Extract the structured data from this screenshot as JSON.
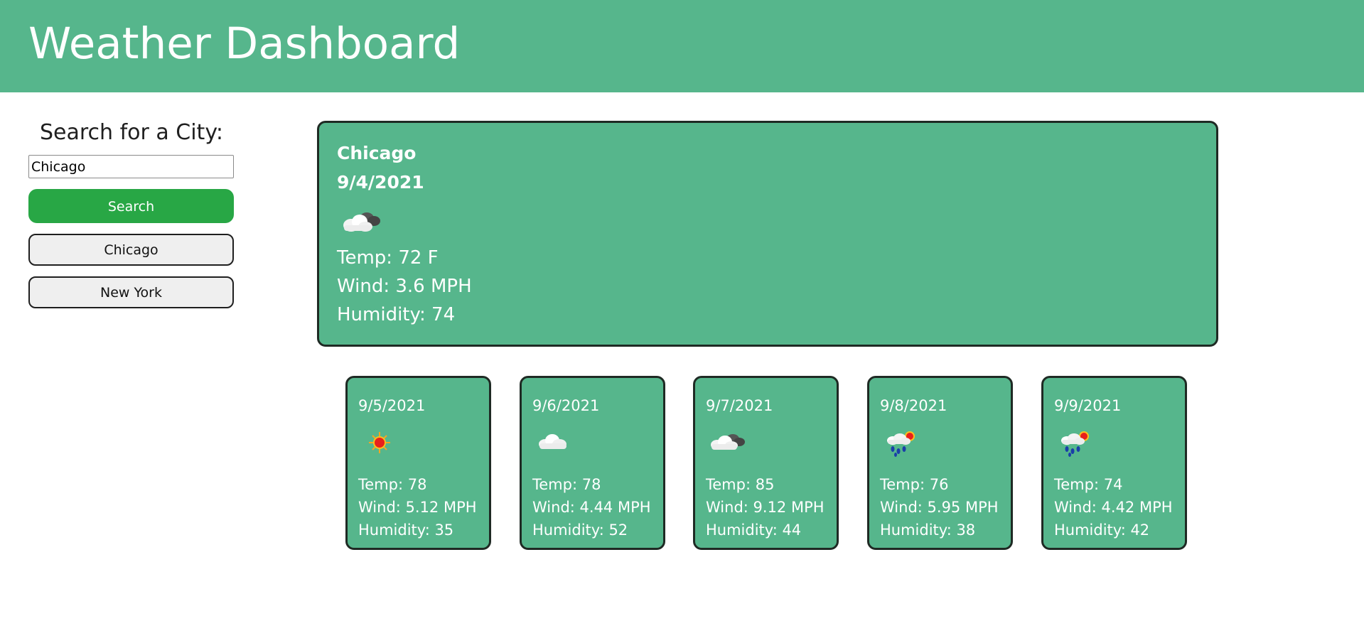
{
  "header": {
    "title": "Weather Dashboard"
  },
  "sidebar": {
    "heading": "Search for a City:",
    "search_value": "Chicago",
    "search_button": "Search",
    "history": [
      "Chicago",
      "New York"
    ]
  },
  "current": {
    "city": "Chicago",
    "date": "9/4/2021",
    "icon": "partly-cloudy-icon",
    "temp": "Temp: 72 F",
    "wind": "Wind: 3.6 MPH",
    "humidity": "Humidity: 74"
  },
  "forecast": [
    {
      "date": "9/5/2021",
      "icon": "sun-icon",
      "temp": "Temp: 78",
      "wind": "Wind: 5.12 MPH",
      "humidity": "Humidity: 35"
    },
    {
      "date": "9/6/2021",
      "icon": "cloud-icon",
      "temp": "Temp: 78",
      "wind": "Wind: 4.44 MPH",
      "humidity": "Humidity: 52"
    },
    {
      "date": "9/7/2021",
      "icon": "partly-cloudy-icon",
      "temp": "Temp: 85",
      "wind": "Wind: 9.12 MPH",
      "humidity": "Humidity: 44"
    },
    {
      "date": "9/8/2021",
      "icon": "rain-sun-icon",
      "temp": "Temp: 76",
      "wind": "Wind: 5.95 MPH",
      "humidity": "Humidity: 38"
    },
    {
      "date": "9/9/2021",
      "icon": "rain-sun-icon",
      "temp": "Temp: 74",
      "wind": "Wind: 4.42 MPH",
      "humidity": "Humidity: 42"
    }
  ],
  "colors": {
    "header_bg": "#56b68c",
    "card_bg": "#56b68c",
    "search_button": "#28a745"
  }
}
